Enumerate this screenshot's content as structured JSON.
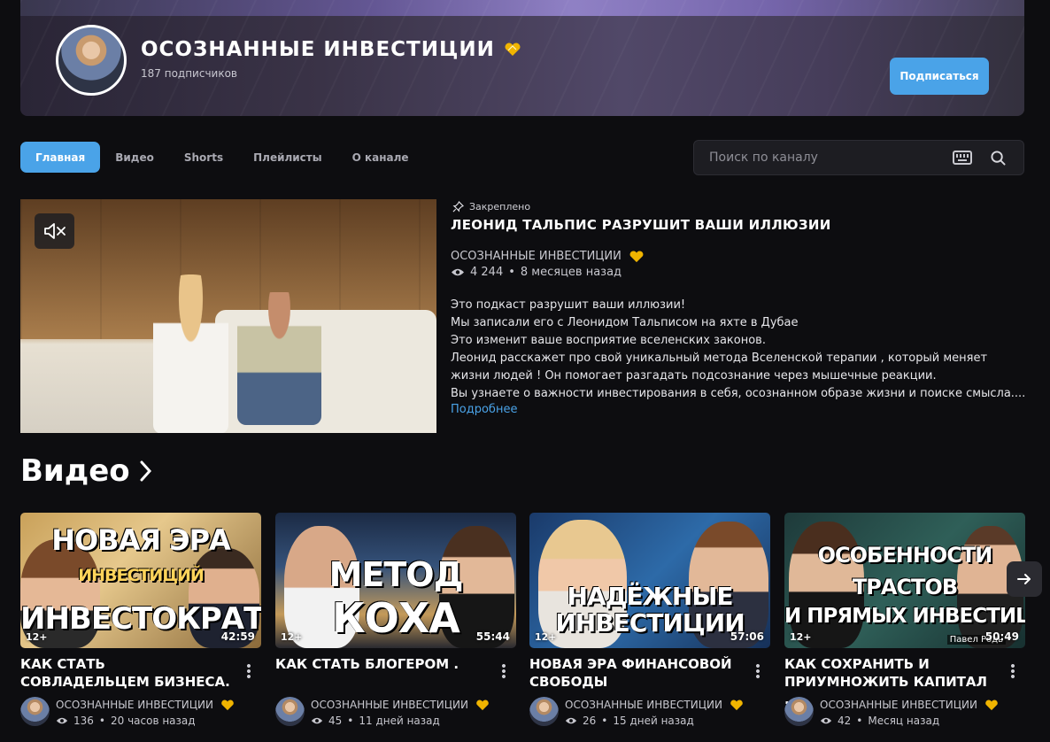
{
  "channel": {
    "name": "ОСОЗНАННЫЕ ИНВЕСТИЦИИ",
    "subscribers": "187 подписчиков",
    "subscribe_label": "Подписаться"
  },
  "tabs": [
    {
      "label": "Главная",
      "active": true
    },
    {
      "label": "Видео"
    },
    {
      "label": "Shorts"
    },
    {
      "label": "Плейлисты"
    },
    {
      "label": "О канале"
    }
  ],
  "search": {
    "placeholder": "Поиск по каналу"
  },
  "featured": {
    "pinned_label": "Закреплено",
    "title": "ЛЕОНИД ТАЛЬПИС РАЗРУШИТ ВАШИ ИЛЛЮЗИИ",
    "channel": "ОСОЗНАННЫЕ ИНВЕСТИЦИИ",
    "views": "4 244",
    "age": "8 месяцев назад",
    "description": [
      "Это подкаст разрушит ваши иллюзии!",
      "Мы записали его с Леонидом Тальписом на яхте в Дубае",
      "Это изменит ваше восприятие вселенских законов.",
      "Леонид расскажет про свой уникальный метода Вселенской терапии , который меняет жизни людей ! Он помогает разгадать подсознание через мышечные реакции.",
      "Вы узнаете о важности инвестирования в себя, осознанном образе жизни и поиске смысла...."
    ],
    "more_label": "Подробнее"
  },
  "videos_section": {
    "title": "Видео"
  },
  "videos": [
    {
      "title": "КАК СТАТЬ СОВЛАДЕЛЬЦЕМ БИЗНЕСА.",
      "thumb_lines": [
        "НОВАЯ ЭРА",
        "ИНВЕСТИЦИЙ",
        "ИНВЕСТОКРАТИЯ"
      ],
      "rating": "12+",
      "duration": "42:59",
      "channel": "ОСОЗНАННЫЕ ИНВЕСТИЦИИ",
      "views": "136",
      "age": "20 часов назад"
    },
    {
      "title": "КАК СТАТЬ БЛОГЕРОМ .",
      "thumb_lines": [
        "МЕТОД",
        "КОХА"
      ],
      "rating": "12+",
      "duration": "55:44",
      "channel": "ОСОЗНАННЫЕ ИНВЕСТИЦИИ",
      "views": "45",
      "age": "11 дней назад"
    },
    {
      "title": "НОВАЯ ЭРА ФИНАНСОВОЙ СВОБОДЫ",
      "thumb_lines": [
        "НАДЁЖНЫЕ",
        "ИНВЕСТИЦИИ"
      ],
      "rating": "12+",
      "duration": "57:06",
      "channel": "ОСОЗНАННЫЕ ИНВЕСТИЦИИ",
      "views": "26",
      "age": "15 дней назад"
    },
    {
      "title": "КАК СОХРАНИТЬ И ПРИУМНОЖИТЬ КАПИТАЛ ...",
      "thumb_lines": [
        "ОСОБЕННОСТИ",
        "ТРАСТОВ",
        "И ПРЯМЫХ ИНВЕСТИЦИЙ"
      ],
      "thumb_caption": "Павел Родь",
      "rating": "12+",
      "duration": "50:49",
      "channel": "ОСОЗНАННЫЕ ИНВЕСТИЦИИ",
      "views": "42",
      "age": "Месяц назад"
    }
  ],
  "colors": {
    "accent": "#4aa3e8",
    "background": "#0d0d10",
    "heart": "#f0b400"
  }
}
